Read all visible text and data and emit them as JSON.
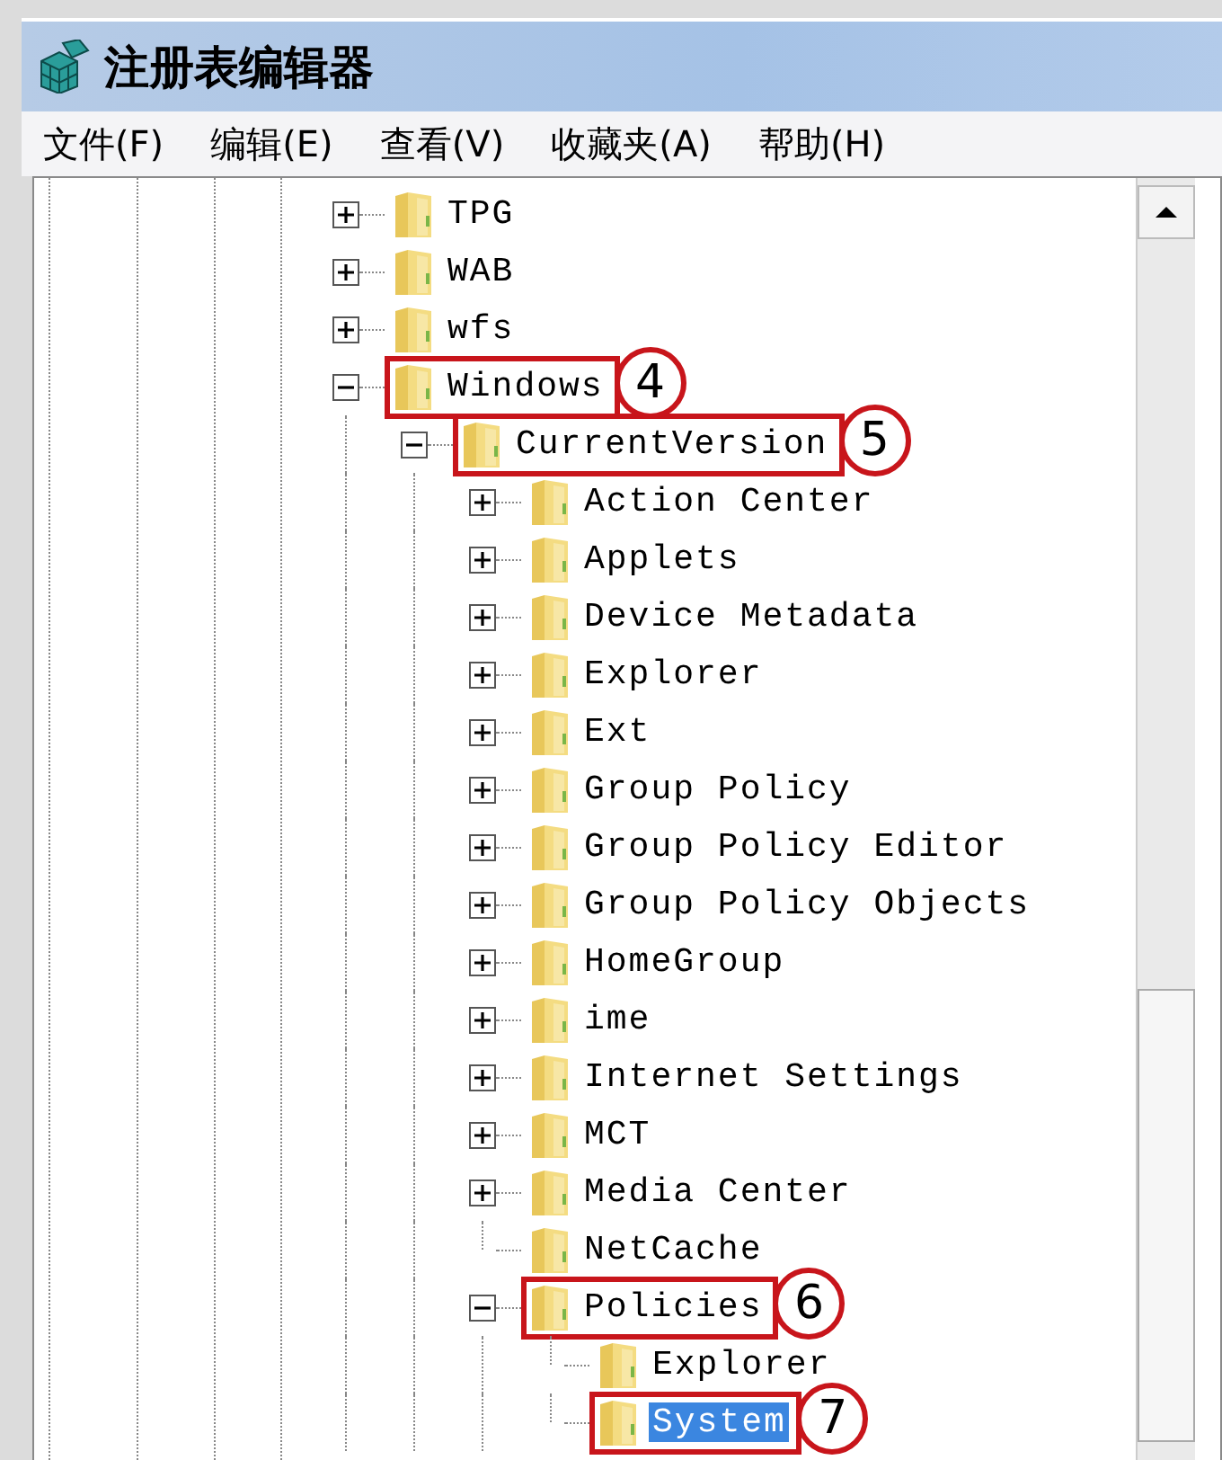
{
  "window": {
    "title": "注册表编辑器"
  },
  "menu": [
    "文件(F)",
    "编辑(E)",
    "查看(V)",
    "收藏夹(A)",
    "帮助(H)"
  ],
  "tree": [
    {
      "label": "TPG",
      "kind": "collapsed",
      "selected": false
    },
    {
      "label": "WAB",
      "kind": "collapsed",
      "selected": false
    },
    {
      "label": "wfs",
      "kind": "collapsed",
      "selected": false
    },
    {
      "label": "Windows",
      "kind": "expanded",
      "selected": false,
      "callout": "4",
      "children": [
        {
          "label": "CurrentVersion",
          "kind": "expanded",
          "selected": false,
          "callout": "5",
          "children": [
            {
              "label": "Action Center",
              "kind": "collapsed",
              "selected": false
            },
            {
              "label": "Applets",
              "kind": "collapsed",
              "selected": false
            },
            {
              "label": "Device Metadata",
              "kind": "collapsed",
              "selected": false
            },
            {
              "label": "Explorer",
              "kind": "collapsed",
              "selected": false
            },
            {
              "label": "Ext",
              "kind": "collapsed",
              "selected": false
            },
            {
              "label": "Group Policy",
              "kind": "collapsed",
              "selected": false
            },
            {
              "label": "Group Policy Editor",
              "kind": "collapsed",
              "selected": false
            },
            {
              "label": "Group Policy Objects",
              "kind": "collapsed",
              "selected": false
            },
            {
              "label": "HomeGroup",
              "kind": "collapsed",
              "selected": false
            },
            {
              "label": "ime",
              "kind": "collapsed",
              "selected": false
            },
            {
              "label": "Internet Settings",
              "kind": "collapsed",
              "selected": false
            },
            {
              "label": "MCT",
              "kind": "collapsed",
              "selected": false
            },
            {
              "label": "Media Center",
              "kind": "collapsed",
              "selected": false
            },
            {
              "label": "NetCache",
              "kind": "leaf",
              "selected": false
            },
            {
              "label": "Policies",
              "kind": "expanded",
              "selected": false,
              "callout": "6",
              "children": [
                {
                  "label": "Explorer",
                  "kind": "leaf",
                  "selected": false
                },
                {
                  "label": "System",
                  "kind": "leaf",
                  "selected": true,
                  "callout": "7"
                }
              ]
            }
          ]
        }
      ]
    }
  ]
}
